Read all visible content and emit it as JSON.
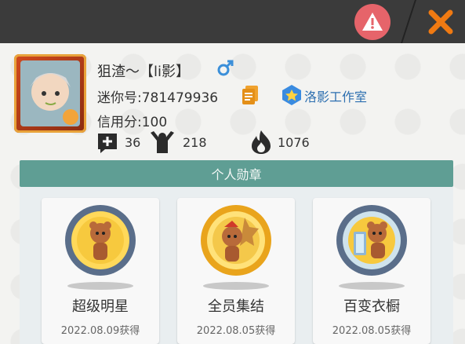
{
  "profile": {
    "name": "狙渣～【li影】",
    "id_line": "迷你号:781479936",
    "studio": "洛影工作室",
    "credit": "信用分:100",
    "stats": {
      "friends": "36",
      "fans": "218",
      "heat": "1076"
    }
  },
  "medals": {
    "section_title": "个人勋章",
    "items": [
      {
        "title": "超级明星",
        "date": "2022.08.09获得"
      },
      {
        "title": "全员集结",
        "date": "2022.08.05获得"
      },
      {
        "title": "百变衣橱",
        "date": "2022.08.05获得"
      }
    ]
  },
  "colors": {
    "accent_teal": "#5f9e94",
    "gender_blue": "#3b8fd9",
    "close_orange": "#f07a12",
    "warn_red": "#e6646a"
  },
  "icons": [
    "warning-icon",
    "close-icon",
    "male-icon",
    "copy-icon",
    "studio-badge-icon",
    "add-friend-icon",
    "fans-icon",
    "heat-icon"
  ]
}
